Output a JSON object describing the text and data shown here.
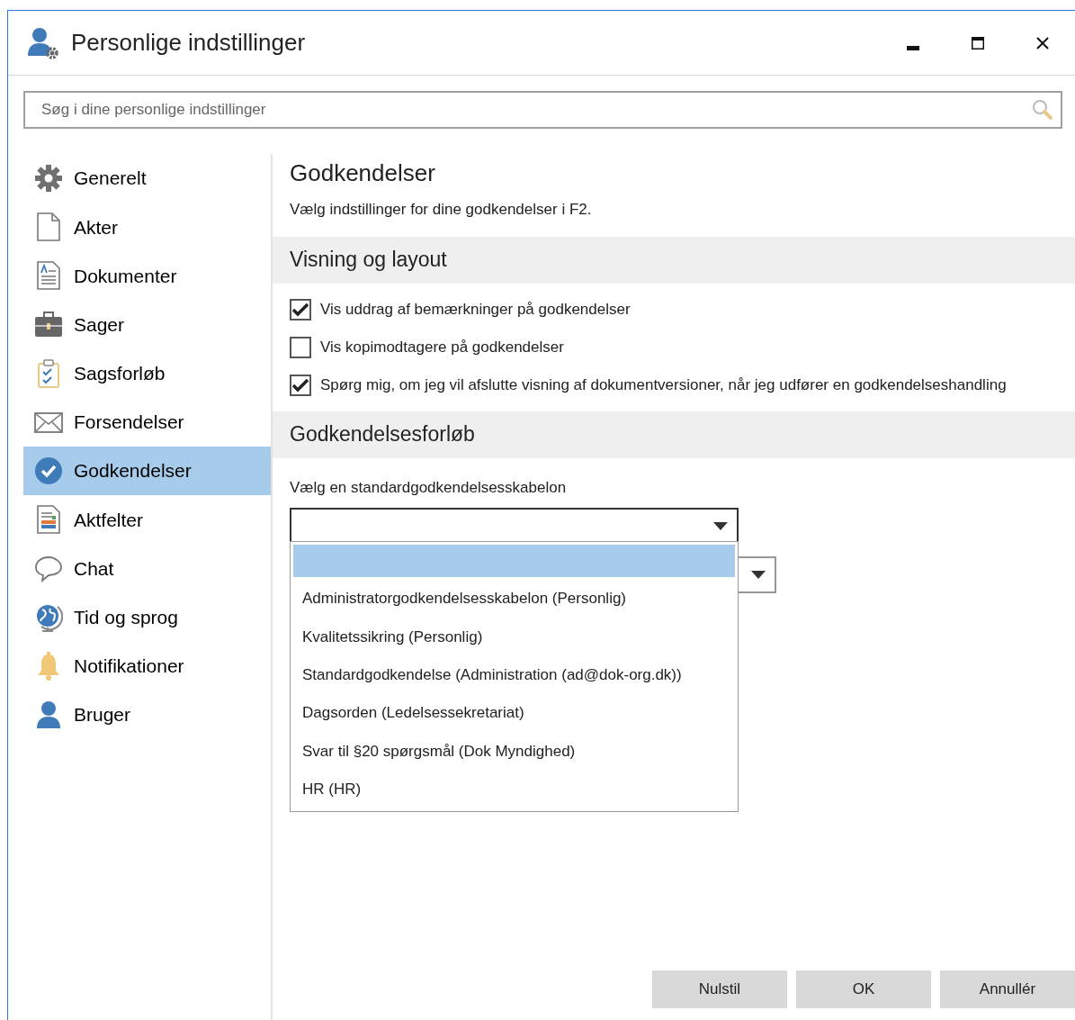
{
  "window": {
    "title": "Personlige indstillinger"
  },
  "search": {
    "placeholder": "Søg i dine personlige indstillinger"
  },
  "sidebar": {
    "items": [
      {
        "label": "Generelt",
        "selected": false
      },
      {
        "label": "Akter",
        "selected": false
      },
      {
        "label": "Dokumenter",
        "selected": false
      },
      {
        "label": "Sager",
        "selected": false
      },
      {
        "label": "Sagsforløb",
        "selected": false
      },
      {
        "label": "Forsendelser",
        "selected": false
      },
      {
        "label": "Godkendelser",
        "selected": true
      },
      {
        "label": "Aktfelter",
        "selected": false
      },
      {
        "label": "Chat",
        "selected": false
      },
      {
        "label": "Tid og sprog",
        "selected": false
      },
      {
        "label": "Notifikationer",
        "selected": false
      },
      {
        "label": "Bruger",
        "selected": false
      }
    ]
  },
  "page": {
    "title": "Godkendelser",
    "description": "Vælg indstillinger for dine godkendelser i F2."
  },
  "sections": [
    {
      "title": "Visning og layout",
      "checkboxes": [
        {
          "label": "Vis uddrag af bemærkninger på godkendelser",
          "checked": true
        },
        {
          "label": "Vis kopimodtagere på godkendelser",
          "checked": false
        },
        {
          "label": "Spørg mig, om jeg vil afslutte visning af dokumentversioner, når jeg udfører en godkendelseshandling",
          "checked": true
        }
      ]
    },
    {
      "title": "Godkendelsesforløb",
      "dropdowns": [
        {
          "label": "Vælg en standardgodkendelsesskabelon",
          "expanded": true,
          "options": [
            {
              "selected": true
            },
            {
              "label": "Administratorgodkendelsesskabelon (Personlig)",
              "selected": false
            },
            {
              "label": "Kvalitetssikring (Personlig)",
              "selected": false
            },
            {
              "label": "Standardgodkendelse (Administration (ad@dok-org.dk))",
              "selected": false
            },
            {
              "label": "Dagsorden (Ledelsessekretariat)",
              "selected": false
            },
            {
              "label": "Svar til §20 spørgsmål (Dok Myndighed)",
              "selected": false
            },
            {
              "label": "HR (HR)",
              "selected": false
            }
          ]
        },
        {
          "expanded": false
        }
      ]
    }
  ],
  "buttons": [
    "Nulstil",
    "OK",
    "Annullér"
  ]
}
